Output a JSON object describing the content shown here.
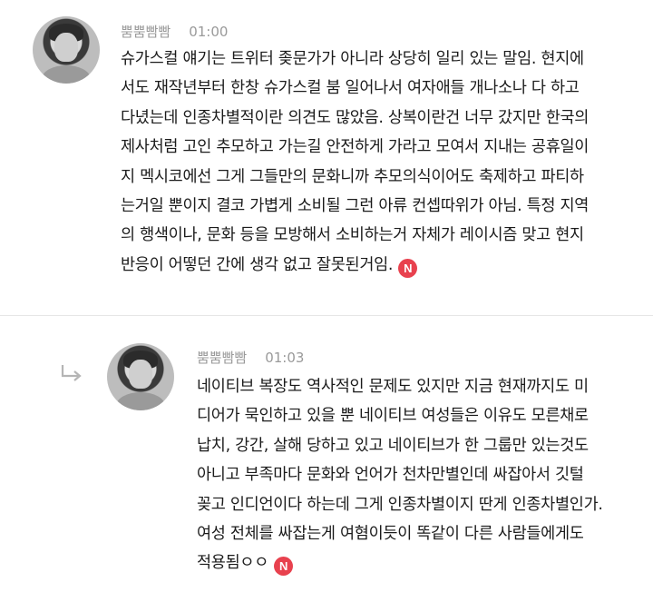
{
  "comments": [
    {
      "username": "뿜뿜빰빰",
      "time": "01:00",
      "text": "슈가스컬 얘기는 트위터 좆문가가 아니라 상당히 일리 있는 말임. 현지에\n서도 재작년부터 한창 슈가스컬 붐 일어나서 여자애들 개나소나 다 하고\n다녔는데 인종차별적이란 의견도 많았음. 상복이란건 너무 갔지만 한국의\n제사처럼 고인 추모하고 가는길 안전하게 가라고 모여서 지내는 공휴일이\n지 멕시코에선 그게 그들만의 문화니까 추모의식이어도 축제하고 파티하\n는거일 뿐이지 결코 가볍게 소비될 그런 아류 컨셉따위가 아님. 특정 지역\n의 행색이나, 문화 등을 모방해서 소비하는거 자체가 레이시즘 맞고 현지\n반응이 어떻던 간에 생각 없고 잘못된거임.",
      "badge": "N"
    },
    {
      "username": "뿜뿜빰빰",
      "time": "01:03",
      "text": "네이티브 복장도 역사적인 문제도 있지만 지금 현재까지도 미\n디어가 묵인하고 있을 뿐 네이티브 여성들은 이유도 모른채로\n납치, 강간, 살해 당하고 있고 네이티브가 한 그룹만 있는것도\n아니고 부족마다 문화와 언어가 천차만별인데 싸잡아서 깃털\n꽂고 인디언이다 하는데 그게 인종차별이지 딴게 인종차별인가.\n여성 전체를 싸잡는게 여혐이듯이 똑같이 다른 사람들에게도\n적용됨ㅇㅇ",
      "badge": "N"
    }
  ]
}
